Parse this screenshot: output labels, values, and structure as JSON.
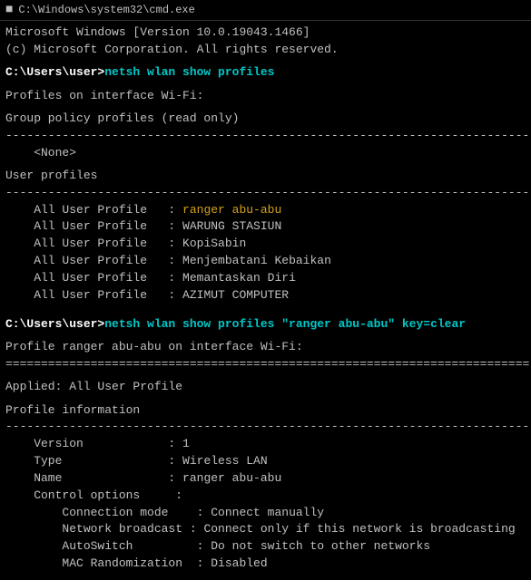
{
  "titleBar": {
    "icon": "■",
    "label": "C:\\Windows\\system32\\cmd.exe"
  },
  "lines": [
    {
      "type": "normal",
      "text": "Microsoft Windows [Version 10.0.19043.1466]"
    },
    {
      "type": "normal",
      "text": "(c) Microsoft Corporation. All rights reserved."
    },
    {
      "type": "blank",
      "text": ""
    },
    {
      "type": "cmd",
      "text": "C:\\Users\\user>",
      "cmd": "netsh wlan show profiles"
    },
    {
      "type": "blank",
      "text": ""
    },
    {
      "type": "normal",
      "text": "Profiles on interface Wi-Fi:"
    },
    {
      "type": "blank",
      "text": ""
    },
    {
      "type": "normal",
      "text": "Group policy profiles (read only)"
    },
    {
      "type": "normal",
      "text": "-----------------------------------------------------------------------------"
    },
    {
      "type": "indent1",
      "text": "<None>"
    },
    {
      "type": "blank",
      "text": ""
    },
    {
      "type": "normal",
      "text": "User profiles"
    },
    {
      "type": "normal",
      "text": "-----------------------------------------------------------------------------"
    },
    {
      "type": "profile",
      "label": "    All User Profile   : ",
      "value": "ranger abu-abu",
      "highlight": "orange"
    },
    {
      "type": "profile",
      "label": "    All User Profile   : ",
      "value": "WARUNG STASIUN",
      "highlight": "none"
    },
    {
      "type": "profile",
      "label": "    All User Profile   : ",
      "value": "KopiSabin",
      "highlight": "none"
    },
    {
      "type": "profile",
      "label": "    All User Profile   : ",
      "value": "Menjembatani Kebaikan",
      "highlight": "none"
    },
    {
      "type": "profile",
      "label": "    All User Profile   : ",
      "value": "Memantaskan Diri",
      "highlight": "none"
    },
    {
      "type": "profile",
      "label": "    All User Profile   : ",
      "value": "AZIMUT COMPUTER",
      "highlight": "none"
    },
    {
      "type": "blank",
      "text": ""
    },
    {
      "type": "blank",
      "text": ""
    },
    {
      "type": "cmd2",
      "prefix": "C:\\Users\\user>",
      "cmd": "netsh wlan show profiles \"ranger abu-abu\" key=clear"
    },
    {
      "type": "blank",
      "text": ""
    },
    {
      "type": "normal",
      "text": "Profile ranger abu-abu on interface Wi-Fi:"
    },
    {
      "type": "normal",
      "text": "=========================================================================="
    },
    {
      "type": "blank",
      "text": ""
    },
    {
      "type": "normal",
      "text": "Applied: All User Profile"
    },
    {
      "type": "blank",
      "text": ""
    },
    {
      "type": "normal",
      "text": "Profile information"
    },
    {
      "type": "normal",
      "text": "--------------------------------------------------------------------------------"
    },
    {
      "type": "field",
      "label": "    Version            : ",
      "value": "1"
    },
    {
      "type": "field",
      "label": "    Type               : ",
      "value": "Wireless LAN"
    },
    {
      "type": "field",
      "label": "    Name               : ",
      "value": "ranger abu-abu"
    },
    {
      "type": "field",
      "label": "    Control options     : ",
      "value": ""
    },
    {
      "type": "field2",
      "label": "        Connection mode    : ",
      "value": "Connect manually"
    },
    {
      "type": "field2",
      "label": "        Network broadcast : ",
      "value": "Connect only if this network is broadcasting"
    },
    {
      "type": "field2",
      "label": "        AutoSwitch         : ",
      "value": "Do not switch to other networks"
    },
    {
      "type": "field2",
      "label": "        MAC Randomization  : ",
      "value": "Disabled"
    }
  ]
}
